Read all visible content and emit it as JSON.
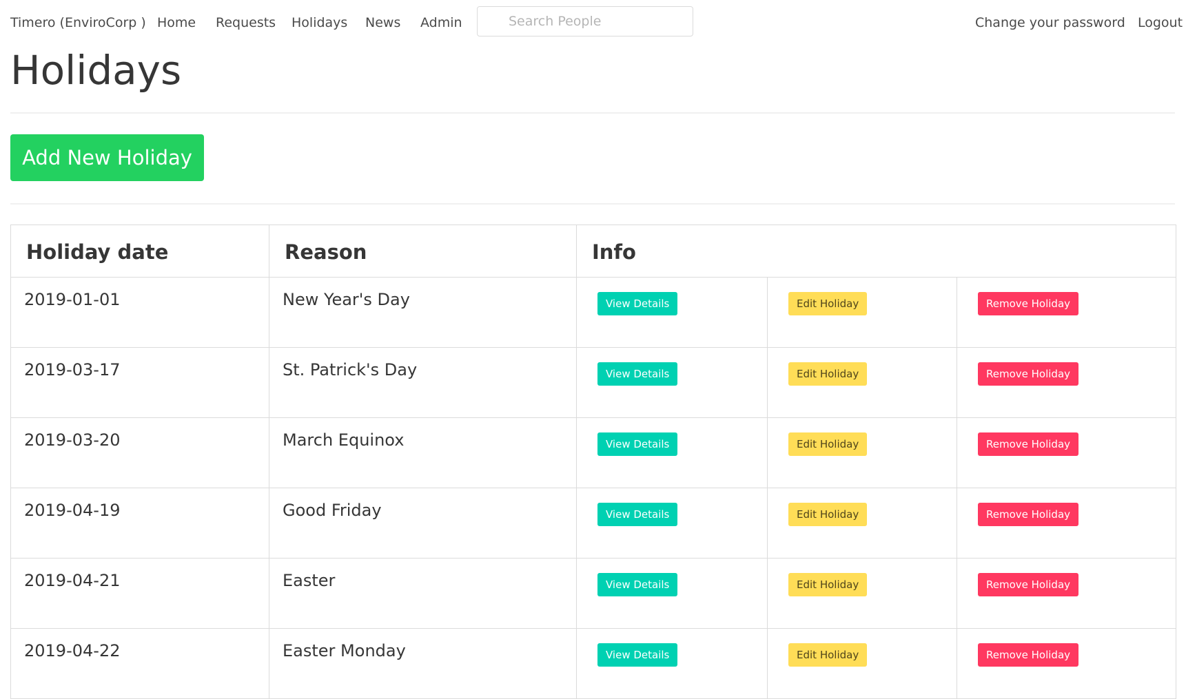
{
  "nav": {
    "brand": "Timero (EnviroCorp )",
    "links": [
      "Home",
      "Requests",
      "Holidays",
      "News",
      "Admin"
    ],
    "search_placeholder": "Search People",
    "change_password": "Change your password",
    "logout": "Logout"
  },
  "page": {
    "title": "Holidays",
    "add_button": "Add New Holiday"
  },
  "table": {
    "headers": [
      "Holiday date",
      "Reason",
      "Info"
    ],
    "button_labels": {
      "view": "View Details",
      "edit": "Edit Holiday",
      "remove": "Remove Holiday"
    },
    "rows": [
      {
        "date": "2019-01-01",
        "reason": "New Year's Day"
      },
      {
        "date": "2019-03-17",
        "reason": "St. Patrick's Day"
      },
      {
        "date": "2019-03-20",
        "reason": "March Equinox"
      },
      {
        "date": "2019-04-19",
        "reason": "Good Friday"
      },
      {
        "date": "2019-04-21",
        "reason": "Easter"
      },
      {
        "date": "2019-04-22",
        "reason": "Easter Monday"
      }
    ]
  },
  "colors": {
    "primary": "#23d160",
    "view": "#00d1b2",
    "edit": "#ffdd57",
    "remove": "#ff3860"
  }
}
